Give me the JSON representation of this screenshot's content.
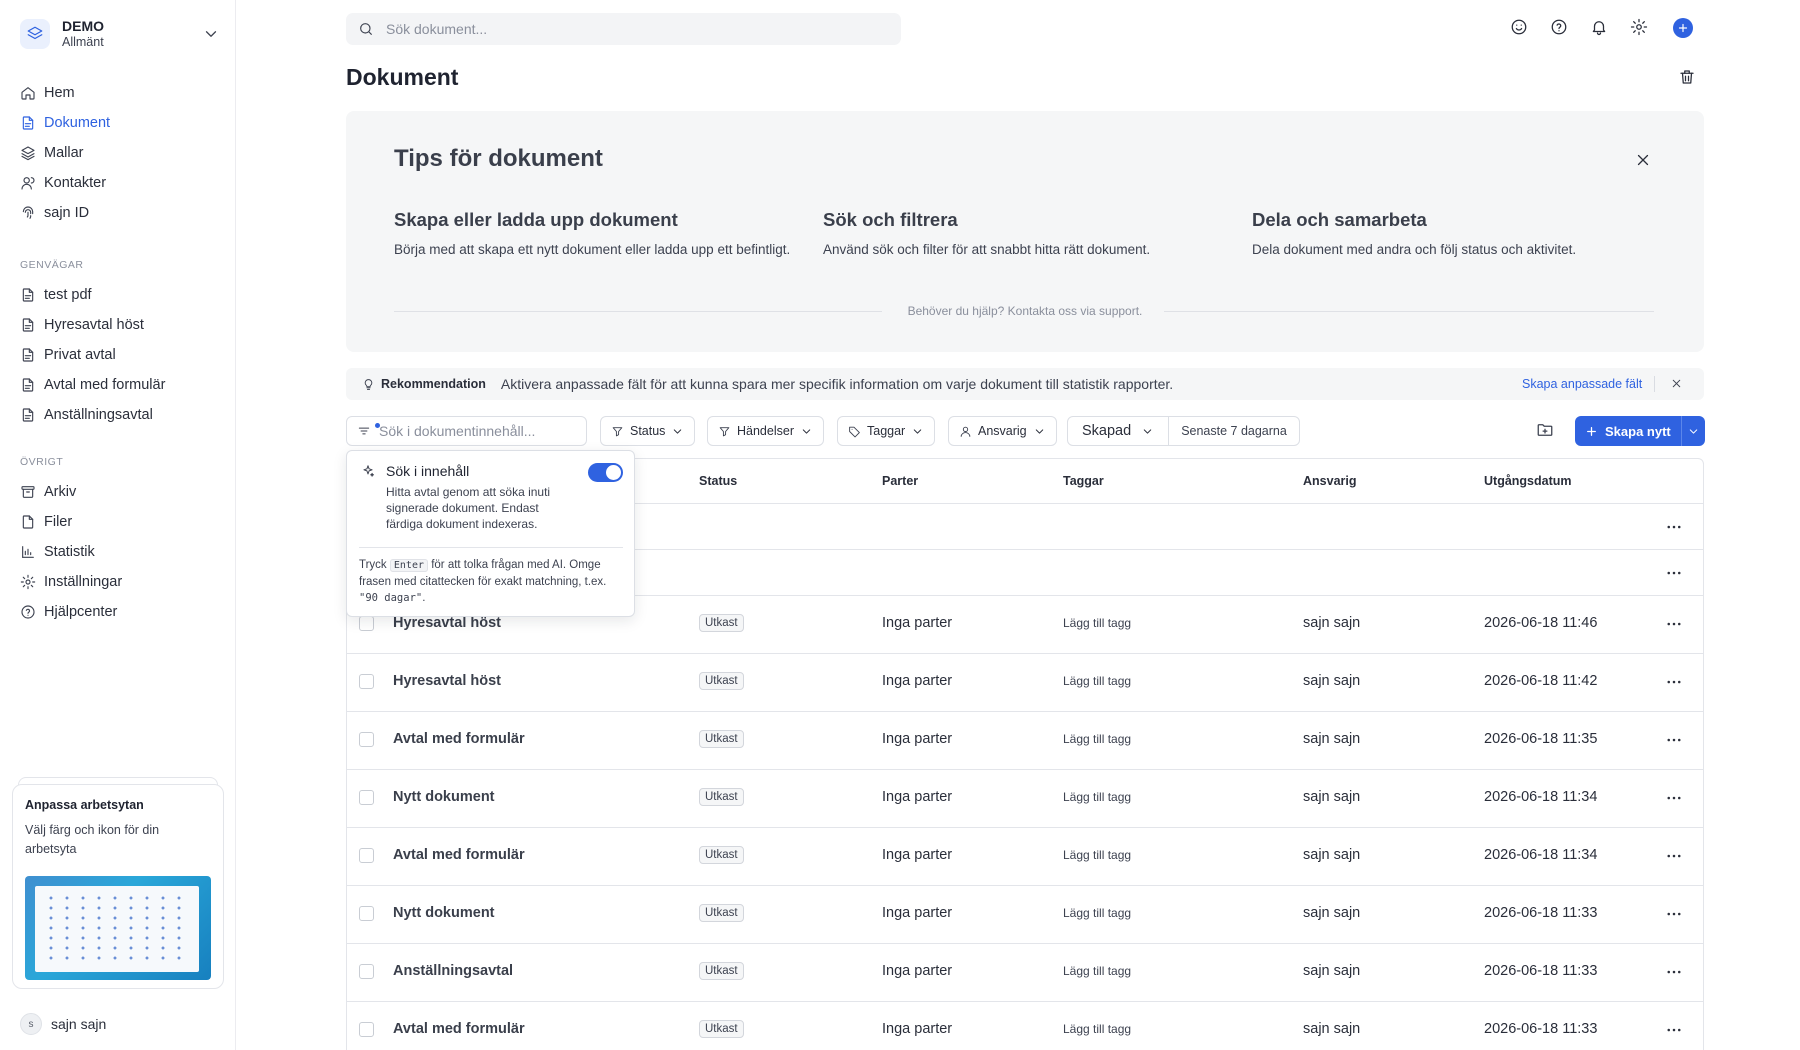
{
  "workspace": {
    "name": "DEMO",
    "subtitle": "Allmänt"
  },
  "nav": [
    {
      "label": "Hem",
      "icon": "home-icon"
    },
    {
      "label": "Dokument",
      "icon": "document-icon",
      "active": true
    },
    {
      "label": "Mallar",
      "icon": "layers-icon"
    },
    {
      "label": "Kontakter",
      "icon": "contacts-icon"
    },
    {
      "label": "sajn ID",
      "icon": "fingerprint-icon"
    }
  ],
  "shortcuts": {
    "heading": "GENVÄGAR",
    "items": [
      "test pdf",
      "Hyresavtal höst",
      "Privat avtal",
      "Avtal med formulär",
      "Anställningsavtal"
    ]
  },
  "other": {
    "heading": "ÖVRIGT",
    "items": [
      {
        "label": "Arkiv",
        "icon": "archive-icon"
      },
      {
        "label": "Filer",
        "icon": "file-icon"
      },
      {
        "label": "Statistik",
        "icon": "chart-icon"
      },
      {
        "label": "Inställningar",
        "icon": "gear-icon"
      },
      {
        "label": "Hjälpcenter",
        "icon": "help-icon"
      }
    ]
  },
  "promo": {
    "title": "Anpassa arbetsytan",
    "description": "Välj färg och ikon för din arbetsyta"
  },
  "user": {
    "initial": "s",
    "name": "sajn sajn"
  },
  "search": {
    "placeholder": "Sök dokument..."
  },
  "page": {
    "title": "Dokument"
  },
  "tips": {
    "title": "Tips för dokument",
    "items": [
      {
        "heading": "Skapa eller ladda upp dokument",
        "text": "Börja med att skapa ett nytt dokument eller ladda upp ett befintligt."
      },
      {
        "heading": "Sök och filtrera",
        "text": "Använd sök och filter för att snabbt hitta rätt dokument."
      },
      {
        "heading": "Dela och samarbeta",
        "text": "Dela dokument med andra och följ status och aktivitet."
      }
    ],
    "help": "Behöver du hjälp? Kontakta oss via support."
  },
  "recommendation": {
    "label": "Rekommendation",
    "text": "Aktivera anpassade fält för att kunna spara mer specifik information om varje dokument till statistik rapporter.",
    "link": "Skapa anpassade fält"
  },
  "filters": {
    "content_search_placeholder": "Sök i dokumentinnehåll...",
    "status": "Status",
    "events": "Händelser",
    "tags": "Taggar",
    "owner": "Ansvarig",
    "created": "Skapad",
    "range": "Senaste 7 dagarna",
    "create": "Skapa nytt"
  },
  "popover": {
    "title": "Sök i innehåll",
    "description": "Hitta avtal genom att söka inuti signerade dokument. Endast färdiga dokument indexeras.",
    "hint_pre": "Tryck",
    "hint_key": "Enter",
    "hint_mid": "för att tolka frågan med AI. Omge frasen med citattecken för exakt matchning, t.ex.",
    "hint_example": "\"90 dagar\"",
    "hint_end": ".",
    "enabled": true
  },
  "table": {
    "columns": {
      "status": "Status",
      "parties": "Parter",
      "tags": "Taggar",
      "owner": "Ansvarig",
      "expiry": "Utgångsdatum"
    },
    "rows": [
      {
        "name": "Hyresavtal höst",
        "status": "Utkast",
        "parties": "Inga parter",
        "tags": "Lägg till tagg",
        "owner": "sajn sajn",
        "date": "2026-06-18 11:46"
      },
      {
        "name": "Hyresavtal höst",
        "status": "Utkast",
        "parties": "Inga parter",
        "tags": "Lägg till tagg",
        "owner": "sajn sajn",
        "date": "2026-06-18 11:42"
      },
      {
        "name": "Avtal med formulär",
        "status": "Utkast",
        "parties": "Inga parter",
        "tags": "Lägg till tagg",
        "owner": "sajn sajn",
        "date": "2026-06-18 11:35"
      },
      {
        "name": "Nytt dokument",
        "status": "Utkast",
        "parties": "Inga parter",
        "tags": "Lägg till tagg",
        "owner": "sajn sajn",
        "date": "2026-06-18 11:34"
      },
      {
        "name": "Avtal med formulär",
        "status": "Utkast",
        "parties": "Inga parter",
        "tags": "Lägg till tagg",
        "owner": "sajn sajn",
        "date": "2026-06-18 11:34"
      },
      {
        "name": "Nytt dokument",
        "status": "Utkast",
        "parties": "Inga parter",
        "tags": "Lägg till tagg",
        "owner": "sajn sajn",
        "date": "2026-06-18 11:33"
      },
      {
        "name": "Anställningsavtal",
        "status": "Utkast",
        "parties": "Inga parter",
        "tags": "Lägg till tagg",
        "owner": "sajn sajn",
        "date": "2026-06-18 11:33"
      },
      {
        "name": "Avtal med formulär",
        "status": "Utkast",
        "parties": "Inga parter",
        "tags": "Lägg till tagg",
        "owner": "sajn sajn",
        "date": "2026-06-18 11:33"
      }
    ]
  },
  "colors": {
    "accent": "#2f62e0",
    "text": "#1f2330",
    "muted": "#8a8f9c",
    "panel": "#f5f6f7"
  }
}
